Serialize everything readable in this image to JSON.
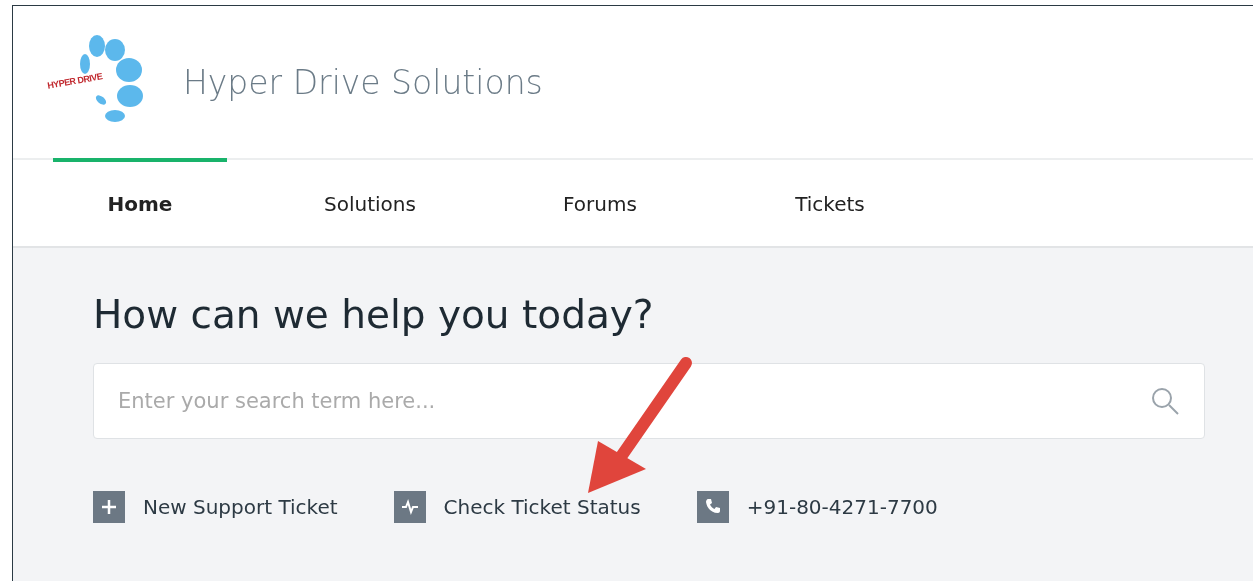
{
  "logo": {
    "text": "HYPER DRIVE"
  },
  "brand": {
    "title": "Hyper Drive Solutions"
  },
  "tabs": [
    {
      "label": "Home",
      "selected": true
    },
    {
      "label": "Solutions",
      "selected": false
    },
    {
      "label": "Forums",
      "selected": false
    },
    {
      "label": "Tickets",
      "selected": false
    }
  ],
  "hero": {
    "heading": "How can we help you today?"
  },
  "search": {
    "placeholder": "Enter your search term here..."
  },
  "links": [
    {
      "kind": "plus",
      "label": "New Support Ticket"
    },
    {
      "kind": "pulse",
      "label": "Check Ticket Status"
    },
    {
      "kind": "phone",
      "label": "+91-80-4271-7700"
    }
  ]
}
